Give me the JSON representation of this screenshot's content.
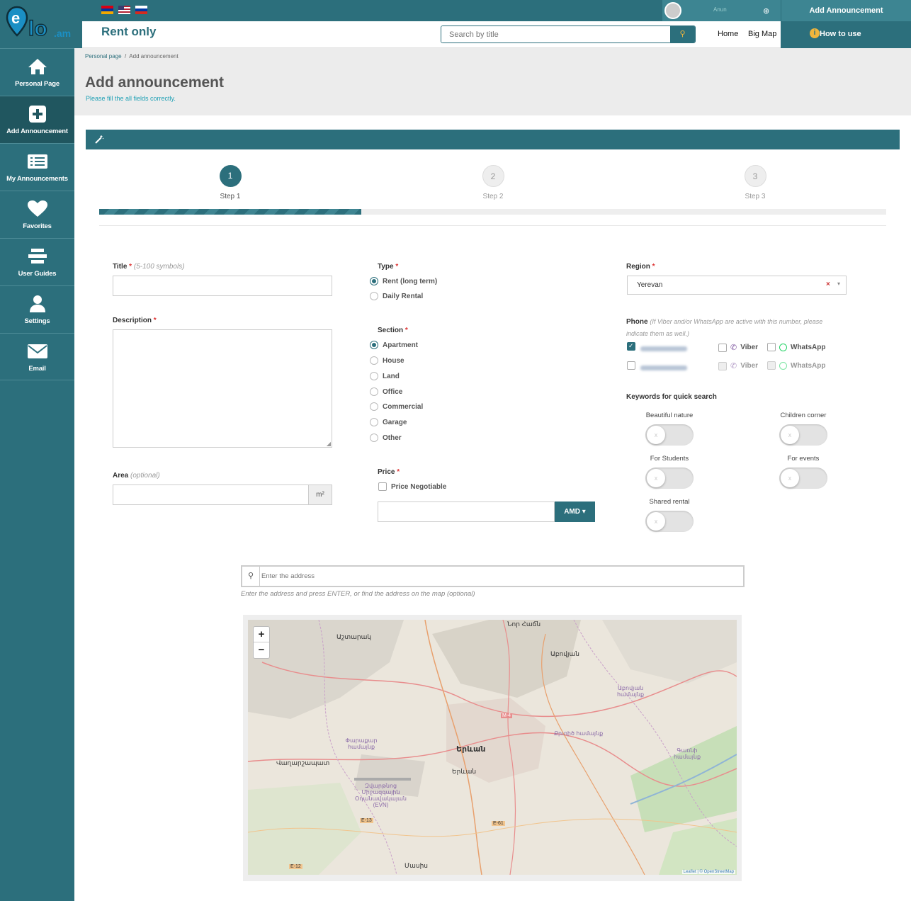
{
  "sidebar": {
    "logo_text": "elo.am",
    "items": [
      {
        "label": "Personal Page",
        "icon": "home-icon"
      },
      {
        "label": "Add Announcement",
        "icon": "plus-square-icon"
      },
      {
        "label": "My Announcements",
        "icon": "list-icon"
      },
      {
        "label": "Favorites",
        "icon": "heart-icon"
      },
      {
        "label": "User Guides",
        "icon": "guides-icon"
      },
      {
        "label": "Settings",
        "icon": "user-icon"
      },
      {
        "label": "Email",
        "icon": "envelope-icon"
      }
    ]
  },
  "topbar": {
    "user_name": "Anun",
    "add_announcement": "Add Announcement",
    "languages": [
      "Armenian",
      "English",
      "Russian"
    ]
  },
  "header": {
    "site_title": "Rent only",
    "search_placeholder": "Search by title",
    "home": "Home",
    "big_map": "Big Map",
    "how_to_use": "How to use"
  },
  "page": {
    "breadcrumb_home": "Personal page",
    "breadcrumb_sep": "/",
    "breadcrumb_current": "Add announcement",
    "title": "Add announcement",
    "subtitle": "Please fill the all fields correctly."
  },
  "steps": [
    {
      "number": "1",
      "label": "Step 1"
    },
    {
      "number": "2",
      "label": "Step 2"
    },
    {
      "number": "3",
      "label": "Step 3"
    }
  ],
  "progress_fraction": 0.333,
  "form": {
    "title_label": "Title",
    "title_hint": "(5-100 symbols)",
    "description_label": "Description",
    "area_label": "Area",
    "area_hint": "(optional)",
    "area_unit": "m²",
    "type_label": "Type",
    "type_options": [
      "Rent (long term)",
      "Daily Rental"
    ],
    "type_selected": "Rent (long term)",
    "section_label": "Section",
    "section_options": [
      "Apartment",
      "House",
      "Land",
      "Office",
      "Commercial",
      "Garage",
      "Other"
    ],
    "section_selected": "Apartment",
    "price_label": "Price",
    "price_negotiable": "Price Negotiable",
    "currency": "AMD",
    "region_label": "Region",
    "region_value": "Yerevan",
    "region_clear": "×",
    "phone_label": "Phone",
    "phone_hint": "(If Viber and/or WhatsApp are active with this number, please indicate them as well.)",
    "viber": "Viber",
    "whatsapp": "WhatsApp",
    "keywords_label": "Keywords for quick search",
    "keywords": [
      "Beautiful nature",
      "Children corner",
      "For Students",
      "For events",
      "Shared rental"
    ],
    "toggle_off_mark": "x",
    "address_placeholder": "Enter the address",
    "address_help": "Enter the address and press ENTER, or find the address on the map (optional)"
  },
  "map": {
    "zoom_in": "+",
    "zoom_out": "−",
    "attribution": "Leaflet | © OpenStreetMap",
    "labels": [
      "Նոր Հաճն",
      "Աշտարակ",
      "Աբովյան",
      "Աբովյան համայնք",
      "Երևան",
      "Երևան",
      "Փարաքար համայնք",
      "Վաղարշապատ",
      "Զվարթնոց Միջազգային Օդանավակայան (EVN)",
      "Քրտիծ համայնք",
      "Գառնի համայնք",
      "Մասիս",
      "M-4",
      "E-61",
      "E-12",
      "E-13"
    ]
  }
}
